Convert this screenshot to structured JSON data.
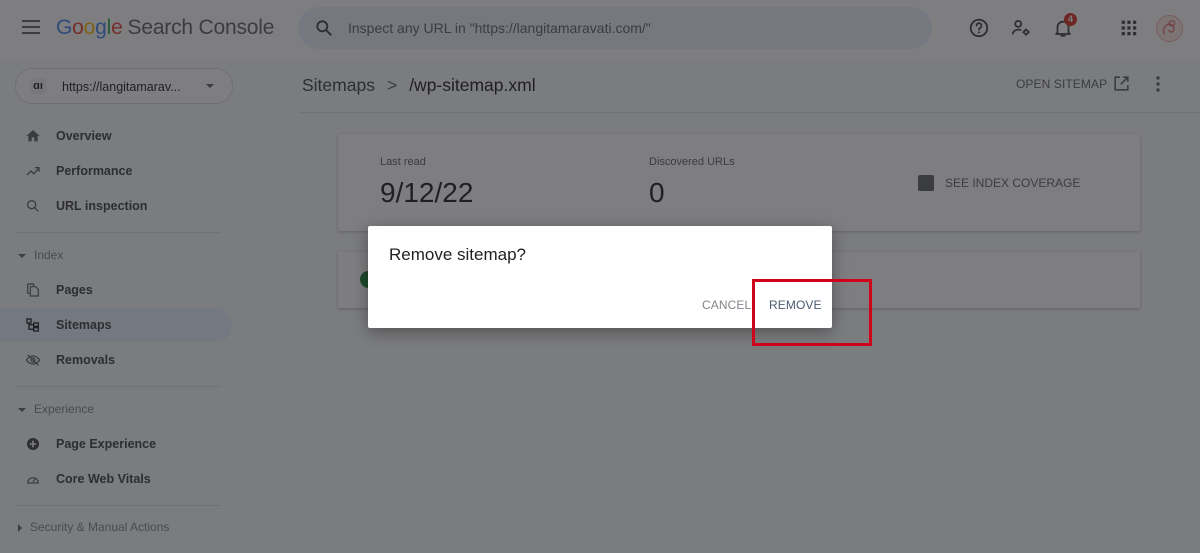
{
  "header": {
    "logo": {
      "google": [
        "G",
        "o",
        "o",
        "g",
        "l",
        "e"
      ],
      "product": "Search Console"
    },
    "search": {
      "placeholder": "Inspect any URL in \"https://langitamaravati.com/\""
    },
    "icons": [
      "menu-icon",
      "search-icon",
      "help-icon",
      "manage-users-icon",
      "notifications-icon",
      "apps-grid-icon",
      "avatar"
    ],
    "notification_count": "4"
  },
  "sidebar": {
    "property": {
      "label": "https://langitamarav...",
      "icon_glyph": "ɑı"
    },
    "items": [
      {
        "label": "Overview",
        "icon": "home-icon"
      },
      {
        "label": "Performance",
        "icon": "trending-up-icon"
      },
      {
        "label": "URL inspection",
        "icon": "search-icon"
      }
    ],
    "sections": [
      {
        "label": "Index",
        "expanded": true,
        "items": [
          {
            "label": "Pages",
            "icon": "pages-icon"
          },
          {
            "label": "Sitemaps",
            "icon": "sitemap-icon",
            "active": true
          },
          {
            "label": "Removals",
            "icon": "removals-icon"
          }
        ]
      },
      {
        "label": "Experience",
        "expanded": true,
        "items": [
          {
            "label": "Page Experience",
            "icon": "page-experience-icon"
          },
          {
            "label": "Core Web Vitals",
            "icon": "speedometer-icon"
          }
        ]
      },
      {
        "label": "Security & Manual Actions",
        "expanded": false,
        "items": []
      }
    ]
  },
  "main": {
    "breadcrumb": {
      "parent": "Sitemaps",
      "separator": ">",
      "current": "/wp-sitemap.xml"
    },
    "open_sitemap_label": "OPEN SITEMAP",
    "stats": {
      "last_read_label": "Last read",
      "last_read_value": "9/12/22",
      "discovered_label": "Discovered URLs",
      "discovered_value": "0"
    },
    "coverage_link": "SEE INDEX COVERAGE"
  },
  "dialog": {
    "title": "Remove sitemap?",
    "cancel_label": "CANCEL",
    "remove_label": "REMOVE"
  },
  "colors": {
    "highlight": "#d0021b",
    "active_nav": "#e8f0fe",
    "search_bg": "#eaf1fb",
    "success": "#188038",
    "badge": "#d93025"
  }
}
